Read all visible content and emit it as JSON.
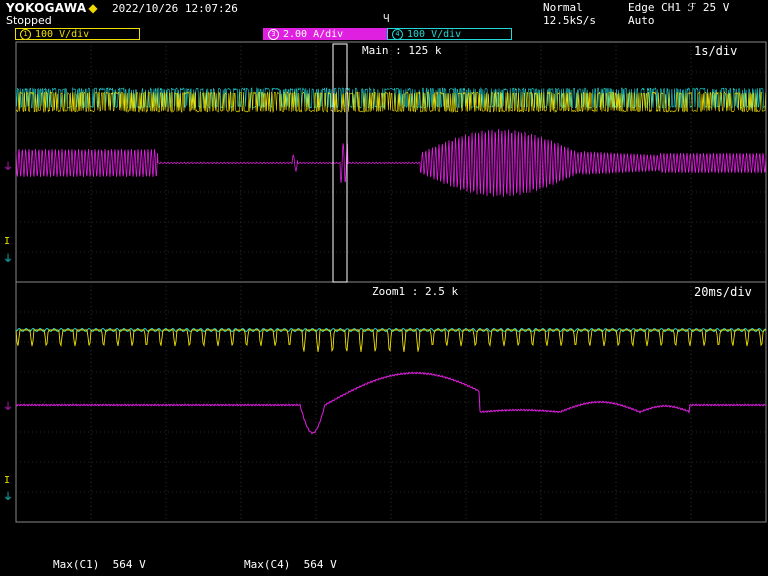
{
  "header": {
    "brand": "YOKOGAWA",
    "status": "Stopped",
    "datetime": "2022/10/26  12:07:26",
    "trigger_mode": "Normal",
    "sample_rate": "12.5kS/s",
    "trigger_source": "Edge CH1 ℱ 25 V",
    "acquisition": "Auto"
  },
  "channels": [
    {
      "num": "1",
      "label": "100 V/div",
      "color": "#f0e000"
    },
    {
      "num": "3",
      "label": "2.00 A/div",
      "color": "#e020e0"
    },
    {
      "num": "4",
      "label": "100 V/div",
      "color": "#20d8d8"
    }
  ],
  "main_window": {
    "label": "Main : 125 k",
    "timebase": "1s/div"
  },
  "zoom_window": {
    "label": "Zoom1 : 2.5 k",
    "timebase": "20ms/div"
  },
  "measurements": [
    {
      "label": "Max(C1)",
      "value": "564 V"
    },
    {
      "label": "Max(C4)",
      "value": "564 V"
    }
  ],
  "colors": {
    "ch1": "#f0e000",
    "ch3": "#e020e0",
    "ch4": "#20d8d8",
    "grid": "#505050",
    "zoom_box": "#ffffff"
  },
  "icons": {
    "brand": "diamond-icon",
    "trigger": "trigger-position-icon",
    "ground": "ground-marker-icon",
    "trigger_level": "trigger-level-icon"
  }
}
